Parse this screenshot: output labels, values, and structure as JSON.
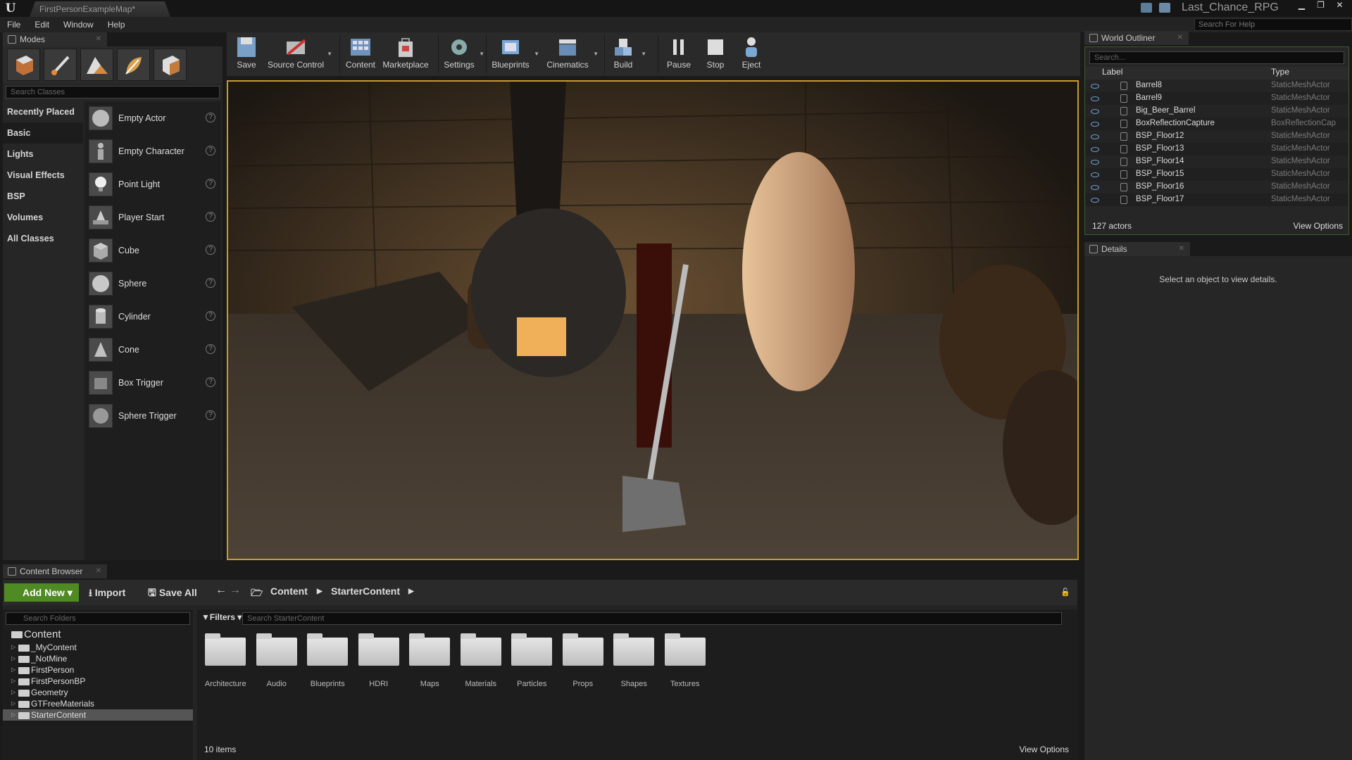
{
  "window": {
    "doc_tab": "FirstPersonExampleMap*",
    "project": "Last_Chance_RPG",
    "min": "▁",
    "max": "❐",
    "close": "✕"
  },
  "menu": [
    "File",
    "Edit",
    "Window",
    "Help"
  ],
  "help_search": {
    "placeholder": "Search For Help"
  },
  "modes": {
    "tab": "Modes",
    "search_placeholder": "Search Classes",
    "categories": [
      "Recently Placed",
      "Basic",
      "Lights",
      "Visual Effects",
      "BSP",
      "Volumes",
      "All Classes"
    ],
    "items": [
      "Empty Actor",
      "Empty Character",
      "Point Light",
      "Player Start",
      "Cube",
      "Sphere",
      "Cylinder",
      "Cone",
      "Box Trigger",
      "Sphere Trigger"
    ]
  },
  "toolbar": {
    "save": "Save",
    "source_control": "Source Control",
    "content": "Content",
    "marketplace": "Marketplace",
    "settings": "Settings",
    "blueprints": "Blueprints",
    "cinematics": "Cinematics",
    "build": "Build",
    "pause": "Pause",
    "stop": "Stop",
    "eject": "Eject"
  },
  "outliner": {
    "tab": "World Outliner",
    "search_placeholder": "Search...",
    "col_label": "Label",
    "col_type": "Type",
    "rows": [
      {
        "name": "Barrel8",
        "type": "StaticMeshActor"
      },
      {
        "name": "Barrel9",
        "type": "StaticMeshActor"
      },
      {
        "name": "Big_Beer_Barrel",
        "type": "StaticMeshActor"
      },
      {
        "name": "BoxReflectionCapture",
        "type": "BoxReflectionCap"
      },
      {
        "name": "BSP_Floor12",
        "type": "StaticMeshActor"
      },
      {
        "name": "BSP_Floor13",
        "type": "StaticMeshActor"
      },
      {
        "name": "BSP_Floor14",
        "type": "StaticMeshActor"
      },
      {
        "name": "BSP_Floor15",
        "type": "StaticMeshActor"
      },
      {
        "name": "BSP_Floor16",
        "type": "StaticMeshActor"
      },
      {
        "name": "BSP_Floor17",
        "type": "StaticMeshActor"
      }
    ],
    "count": "127 actors",
    "view_options": "View Options"
  },
  "details": {
    "tab": "Details",
    "message": "Select an object to view details."
  },
  "content_browser": {
    "tab": "Content Browser",
    "add_new": "Add New",
    "import": "Import",
    "save_all": "Save All",
    "breadcrumb": [
      "Content",
      "StarterContent"
    ],
    "folder_search_placeholder": "Search Folders",
    "filters": "Filters",
    "asset_search_placeholder": "Search StarterContent",
    "tree": [
      "Content",
      "_MyContent",
      "_NotMine",
      "FirstPerson",
      "FirstPersonBP",
      "Geometry",
      "GTFreeMaterials",
      "StarterContent"
    ],
    "folders": [
      "Architecture",
      "Audio",
      "Blueprints",
      "HDRI",
      "Maps",
      "Materials",
      "Particles",
      "Props",
      "Shapes",
      "Textures"
    ],
    "item_count": "10 items",
    "view_options": "View Options"
  },
  "colors": {
    "accent_green": "#4f8a23",
    "viewport_border": "#c89c2a",
    "eye_blue": "#6ea1d0"
  }
}
